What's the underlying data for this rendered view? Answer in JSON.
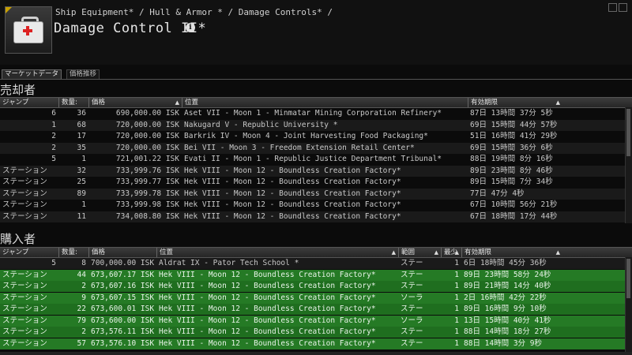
{
  "header": {
    "breadcrumb": "Ship Equipment* / Hull & Armor * / Damage Controls* /",
    "title": "Damage Control II*",
    "info_icon": "i"
  },
  "tabs": [
    {
      "label": "マーケットデータ"
    },
    {
      "label": "価格推移"
    }
  ],
  "sellers": {
    "title": "売却者",
    "columns": [
      "ジャンプ",
      "数量:",
      "価格",
      "位置",
      "有効期限"
    ],
    "rows": [
      {
        "jumps": "6",
        "qty": "36",
        "price": "690,000.00 ISK",
        "location": "Aset VII - Moon 1 - Minmatar Mining Corporation Refinery*",
        "expires": "87日 13時間 37分 5秒"
      },
      {
        "jumps": "1",
        "qty": "68",
        "price": "720,000.00 ISK",
        "location": "Nakugard V - Republic University *",
        "expires": "69日 15時間 44分 57秒"
      },
      {
        "jumps": "2",
        "qty": "17",
        "price": "720,000.00 ISK",
        "location": "Barkrik IV - Moon 4 - Joint Harvesting Food Packaging*",
        "expires": "51日 16時間 41分 29秒"
      },
      {
        "jumps": "2",
        "qty": "35",
        "price": "720,000.00 ISK",
        "location": "Bei VII - Moon 3 - Freedom Extension Retail Center*",
        "expires": "69日 15時間 36分 6秒"
      },
      {
        "jumps": "5",
        "qty": "1",
        "price": "721,001.22 ISK",
        "location": "Evati II - Moon 1 - Republic Justice Department Tribunal*",
        "expires": "88日 19時間 8分 16秒"
      },
      {
        "jumps": "ステーション",
        "qty": "32",
        "price": "733,999.76 ISK",
        "location": "Hek VIII - Moon 12 - Boundless Creation Factory*",
        "expires": "89日 23時間 8分 46秒"
      },
      {
        "jumps": "ステーション",
        "qty": "25",
        "price": "733,999.77 ISK",
        "location": "Hek VIII - Moon 12 - Boundless Creation Factory*",
        "expires": "89日 15時間 7分 34秒"
      },
      {
        "jumps": "ステーション",
        "qty": "89",
        "price": "733,999.78 ISK",
        "location": "Hek VIII - Moon 12 - Boundless Creation Factory*",
        "expires": "77日 47分 4秒"
      },
      {
        "jumps": "ステーション",
        "qty": "1",
        "price": "733,999.98 ISK",
        "location": "Hek VIII - Moon 12 - Boundless Creation Factory*",
        "expires": "67日 10時間 56分 21秒"
      },
      {
        "jumps": "ステーション",
        "qty": "11",
        "price": "734,008.80 ISK",
        "location": "Hek VIII - Moon 12 - Boundless Creation Factory*",
        "expires": "67日 18時間 17分 44秒"
      }
    ]
  },
  "buyers": {
    "title": "購入者",
    "columns": [
      "ジャンプ",
      "数量:",
      "価格",
      "位置",
      "範囲",
      "最少",
      "有効期限"
    ],
    "rows": [
      {
        "jumps": "5",
        "qty": "8",
        "price": "700,000.00 ISK",
        "location": "Aldrat IX - Pator Tech School *",
        "range": "ステー",
        "min": "1",
        "expires": "6日 18時間 45分 36秒",
        "highlight": false
      },
      {
        "jumps": "ステーション",
        "qty": "44",
        "price": "673,607.17 ISK",
        "location": "Hek VIII - Moon 12 - Boundless Creation Factory*",
        "range": "ステー",
        "min": "1",
        "expires": "89日 23時間 58分 24秒",
        "highlight": true
      },
      {
        "jumps": "ステーション",
        "qty": "2",
        "price": "673,607.16 ISK",
        "location": "Hek VIII - Moon 12 - Boundless Creation Factory*",
        "range": "ステー",
        "min": "1",
        "expires": "89日 21時間 14分 40秒",
        "highlight": true
      },
      {
        "jumps": "ステーション",
        "qty": "9",
        "price": "673,607.15 ISK",
        "location": "Hek VIII - Moon 12 - Boundless Creation Factory*",
        "range": "ソーラ",
        "min": "1",
        "expires": "2日 16時間 42分 22秒",
        "highlight": true
      },
      {
        "jumps": "ステーション",
        "qty": "22",
        "price": "673,600.01 ISK",
        "location": "Hek VIII - Moon 12 - Boundless Creation Factory*",
        "range": "ステー",
        "min": "1",
        "expires": "89日 16時間 9分 10秒",
        "highlight": true
      },
      {
        "jumps": "ステーション",
        "qty": "79",
        "price": "673,600.00 ISK",
        "location": "Hek VIII - Moon 12 - Boundless Creation Factory*",
        "range": "ソーラ",
        "min": "1",
        "expires": "13日 15時間 40分 41秒",
        "highlight": true
      },
      {
        "jumps": "ステーション",
        "qty": "2",
        "price": "673,576.11 ISK",
        "location": "Hek VIII - Moon 12 - Boundless Creation Factory*",
        "range": "ステー",
        "min": "1",
        "expires": "88日 14時間 18分 27秒",
        "highlight": true
      },
      {
        "jumps": "ステーション",
        "qty": "57",
        "price": "673,576.10 ISK",
        "location": "Hek VIII - Moon 12 - Boundless Creation Factory*",
        "range": "ステー",
        "min": "1",
        "expires": "88日 14時間 3分 9秒",
        "highlight": true
      }
    ]
  },
  "icons": {
    "item_icon": "medkit-icon",
    "sort_icon": "▲",
    "colors": {
      "highlight": "#1f6e1f",
      "header": "#333333",
      "background": "#0b0b0b"
    }
  }
}
